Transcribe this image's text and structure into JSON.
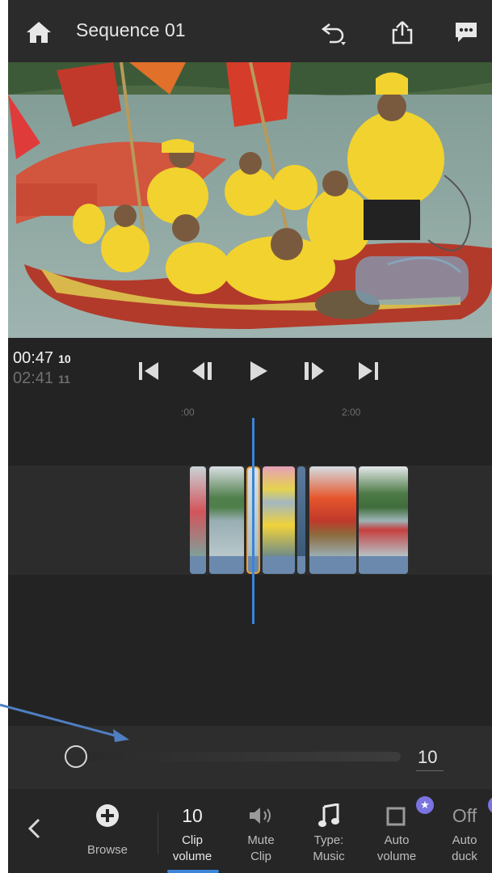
{
  "header": {
    "title": "Sequence 01",
    "icons": [
      "home-icon",
      "undo-icon",
      "share-icon",
      "chat-icon"
    ]
  },
  "transport": {
    "current_time": "00:47",
    "current_frame": "10",
    "duration_time": "02:41",
    "duration_frame": "11",
    "buttons": [
      "skip-to-start",
      "step-back",
      "play",
      "step-forward",
      "skip-to-end"
    ]
  },
  "timeline": {
    "ruler_labels": [
      ":00",
      "2:00"
    ]
  },
  "slider": {
    "label_value": "10",
    "level": 0.0
  },
  "toolbar": {
    "back_icon": "chevron-left-icon",
    "browse_label": "Browse",
    "clip_volume_value": "10",
    "clip_volume_label_1": "Clip",
    "clip_volume_label_2": "volume",
    "mute_label_1": "Mute",
    "mute_label_2": "Clip",
    "type_label_1": "Type:",
    "type_label_2": "Music",
    "auto_volume_label_1": "Auto",
    "auto_volume_label_2": "volume",
    "auto_duck_value": "Off",
    "auto_duck_label_1": "Auto",
    "auto_duck_label_2": "duck"
  },
  "colors": {
    "accent_blue": "#3b84d8",
    "selection_orange": "#f0a030",
    "badge_purple": "#7b73e0",
    "annotation_arrow": "#4f7fc2"
  }
}
